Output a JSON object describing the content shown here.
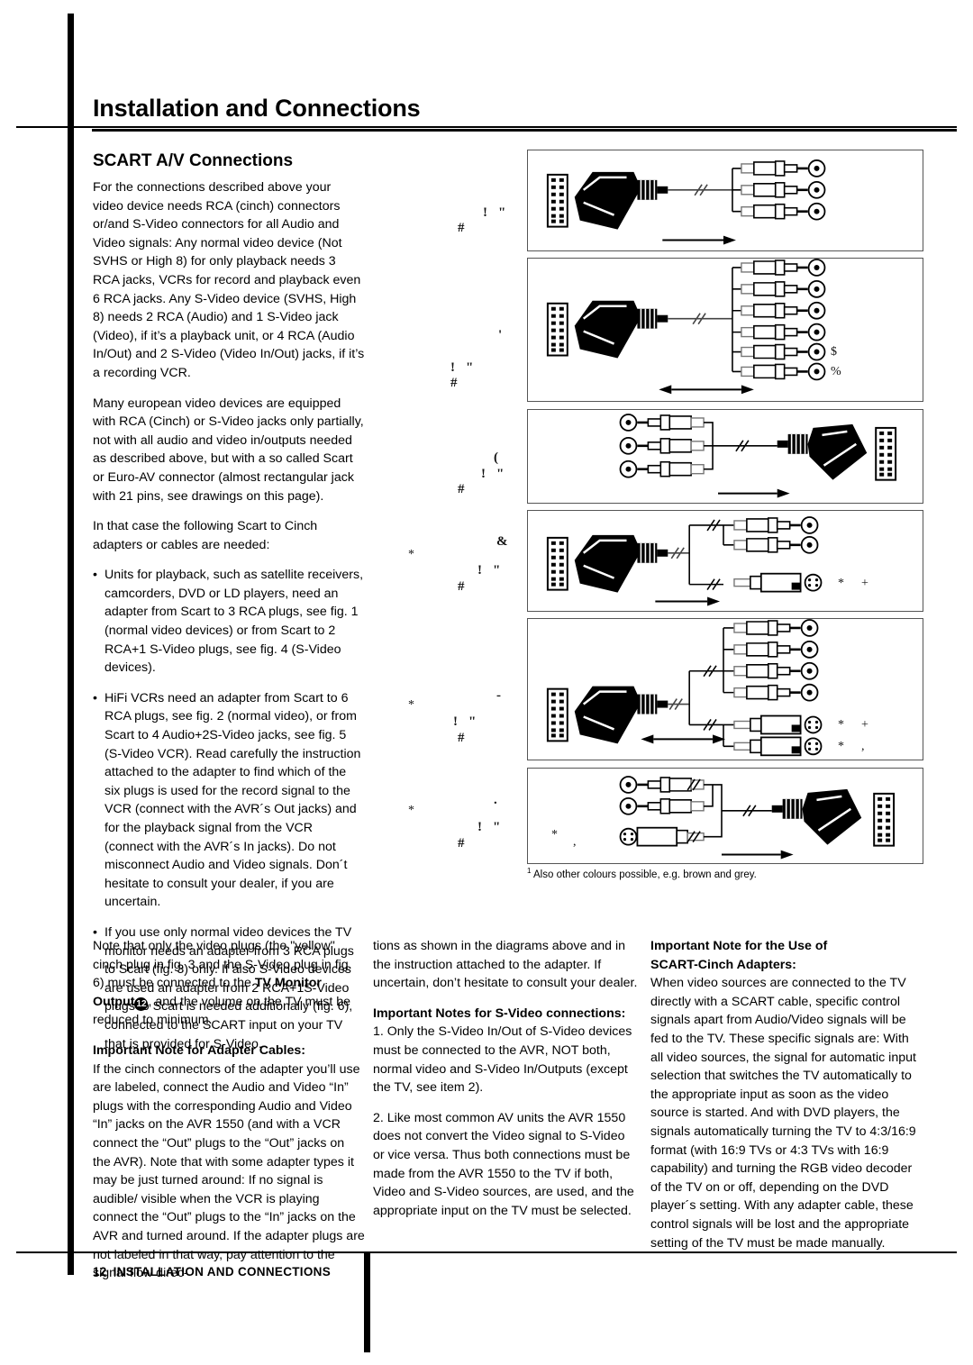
{
  "header": {
    "title": "Installation and Connections"
  },
  "section": {
    "title": "SCART A/V Connections"
  },
  "body": {
    "p1": "For the connections described above your video device needs RCA (cinch) connectors or/and S-Video connectors for all Audio and Video signals: Any normal video device (Not SVHS or High 8) for only playback needs 3 RCA jacks, VCRs for record and playback even 6 RCA jacks. Any S-Video device (SVHS, High 8) needs 2 RCA (Audio) and 1 S-Video jack (Video), if it’s a playback unit, or 4 RCA (Audio In/Out) and 2 S-Video (Video In/Out) jacks, if it’s a recording VCR.",
    "p2": "Many european video devices are equipped with RCA (Cinch) or S-Video jacks only partially, not with all audio and video in/outputs needed as described above, but with a so called Scart or Euro-AV connector (almost rectangular jack with 21 pins, see drawings on this page).",
    "p3": "In that case the following Scart to Cinch adapters or cables are needed:",
    "bullet1": "Units for playback, such as satellite receivers, camcorders, DVD or LD players, need an adapter from Scart to 3 RCA plugs, see fig. 1 (normal video devices) or from Scart to 2 RCA+1 S-Video plugs, see fig. 4 (S-Video devices).",
    "bullet2": "HiFi VCRs need an adapter from Scart to 6 RCA plugs, see fig. 2 (normal video), or from Scart to 4 Audio+2S-Video jacks, see fig. 5 (S-Video VCR). Read carefully the instruction attached to the adapter to find which of the six plugs is used for the record signal to the VCR (connect with the AVR´s Out jacks) and for the playback signal from the VCR (connect with the AVR´s In jacks). Do not misconnect Audio and Video signals. Don´t hesitate to consult your dealer, if you are uncertain.",
    "bullet3": "If you use only normal video devices the TV monitor needs an adapter from 3 RCA plugs to Scart (fig. 3) only. If also S-Video devices are used an adapter from 2 RCA+1S-Video plugs to Scart is needed additionally (fig. 6), connected to the SCART input on your TV that is provided for S-Video.",
    "note_tv_1": "Note that only the video plugs (the \"yellow\" cinch plug in fig. 3 and the S-Video plug in fig. 6) must be connected to the ",
    "note_tv_bold": "TV Monitor Output",
    "note_tv_circled": "12",
    "note_tv_2": ", and the volume on the TV must be reduced to minimum.",
    "adapter_heading": "Important Note for Adapter Cables:",
    "adapter_text": "If the cinch connectors of the adapter you’ll use are labeled, connect the Audio and Video “In” plugs with the corresponding Audio and Video “In” jacks on the AVR 1550 (and with a VCR connect the “Out” plugs to the “Out” jacks on the AVR). Note that with some adapter types it may be just turned around: If no signal is audible/ visible when the VCR is playing connect the “Out” plugs to the “In” jacks on the AVR and turned around. If the adapter plugs are not labeled in that way, pay attention to the signal flow direc-",
    "adapter_text_cont": "tions as shown in the diagrams above and in the instruction attached to the adapter. If uncertain, don’t hesitate to consult your dealer.",
    "svideo_heading": "Important Notes for S-Video connections:",
    "svideo_item1": "1. Only the S-Video In/Out of S-Video devices must be connected to the AVR, NOT both, normal video and S-Video In/Outputs (except the TV, see item 2).",
    "svideo_item2": "2. Like most common AV units the AVR 1550 does not convert the Video signal to S-Video or vice versa. Thus both connections must be made from the AVR 1550 to the TV if both, Video and S-Video sources, are used, and the appropriate input on the TV must be selected.",
    "scart_heading_1": "Important Note for the Use of",
    "scart_heading_2": "SCART-Cinch Adapters:",
    "scart_text": "When video sources are connected to the TV directly with a SCART cable, specific control signals apart from Audio/Video signals will be fed to the TV. These specific signals are: With all video sources, the signal for automatic input selection that switches the TV automatically to the appropriate input as soon as the video source is started. And with DVD players, the signals automatically turning the TV to 4:3/16:9 format (with 16:9 TVs or 4:3 TVs with 16:9 capability) and turning the RGB video decoder of the TV on or off, depending on the DVD player´s setting. With any adapter cable, these control signals will be lost and the appropriate setting of the TV must be made manually."
  },
  "figures": {
    "footnote_marker": "1",
    "footnote": "Also other colours possible, e.g. brown and grey.",
    "labels": [
      {
        "id": "fig1",
        "glyphs": [
          "!",
          "\"",
          "#"
        ]
      },
      {
        "id": "fig2",
        "glyphs": [
          "'",
          "!",
          "\"",
          "#"
        ]
      },
      {
        "id": "fig3",
        "glyphs": [
          "(",
          "!",
          "\"",
          "#"
        ]
      },
      {
        "id": "fig4",
        "glyphs": [
          "&",
          "*",
          "!",
          "\"",
          "#"
        ]
      },
      {
        "id": "fig5",
        "glyphs": [
          "-",
          "*",
          "!",
          "\"",
          "#"
        ]
      },
      {
        "id": "fig6",
        "glyphs": [
          ".",
          "*",
          "!",
          "\"",
          "#"
        ]
      }
    ],
    "plug_labels": {
      "fig2_a": "$",
      "fig2_b": "%",
      "fig4_sv_a": "*",
      "fig4_sv_b": "+",
      "fig5_sv1_a": "*",
      "fig5_sv1_b": "+",
      "fig5_sv2_a": "*",
      "fig5_sv2_b": ",",
      "fig6_sv_a": "*",
      "fig6_sv_b": ","
    }
  },
  "footer": {
    "page_number": "12",
    "label": "INSTALLATION AND CONNECTIONS"
  },
  "colors": {
    "ink": "#000000",
    "frame": "#555555",
    "metal": "#9a9a9a"
  }
}
